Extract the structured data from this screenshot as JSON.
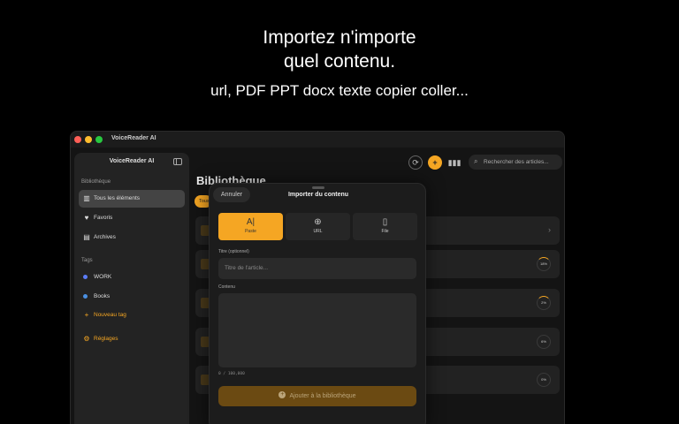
{
  "promo": {
    "line1": "Importez n'importe",
    "line2": "quel contenu.",
    "subtitle": "url, PDF PPT docx texte copier coller..."
  },
  "window": {
    "title": "VoiceReader AI"
  },
  "sidebar": {
    "app_name": "VoiceReader AI",
    "library_section": "Bibliothèque",
    "items": [
      {
        "label": "Tous les éléments",
        "icon": "library-icon",
        "active": true
      },
      {
        "label": "Favoris",
        "icon": "heart-icon",
        "active": false
      },
      {
        "label": "Archives",
        "icon": "archive-icon",
        "active": false
      }
    ],
    "tags_section": "Tags",
    "tags": [
      {
        "label": "WORK",
        "color": "#5b7cf7"
      },
      {
        "label": "Books",
        "color": "#4a90e2"
      }
    ],
    "new_tag": "Nouveau tag",
    "settings": "Réglages"
  },
  "main": {
    "title": "Bibliothèque",
    "filter_chip": "Tous",
    "search_placeholder": "Rechercher des articles...",
    "rows": [
      {
        "progress": ""
      },
      {
        "progress": "18%"
      },
      {
        "progress": "2%"
      },
      {
        "progress": "6%"
      },
      {
        "progress": "0%"
      }
    ]
  },
  "modal": {
    "cancel": "Annuler",
    "title": "Importer du contenu",
    "modes": [
      {
        "label": "Paste",
        "icon": "paste-icon",
        "active": true
      },
      {
        "label": "URL",
        "icon": "globe-icon",
        "active": false
      },
      {
        "label": "File",
        "icon": "file-icon",
        "active": false
      }
    ],
    "title_label": "Titre (optionnel)",
    "title_placeholder": "Titre de l'article...",
    "content_label": "Contenu",
    "counter": "0 / 100,000",
    "add_button": "Ajouter à la bibliothèque"
  },
  "colors": {
    "accent": "#f5a623",
    "background": "#000000"
  }
}
